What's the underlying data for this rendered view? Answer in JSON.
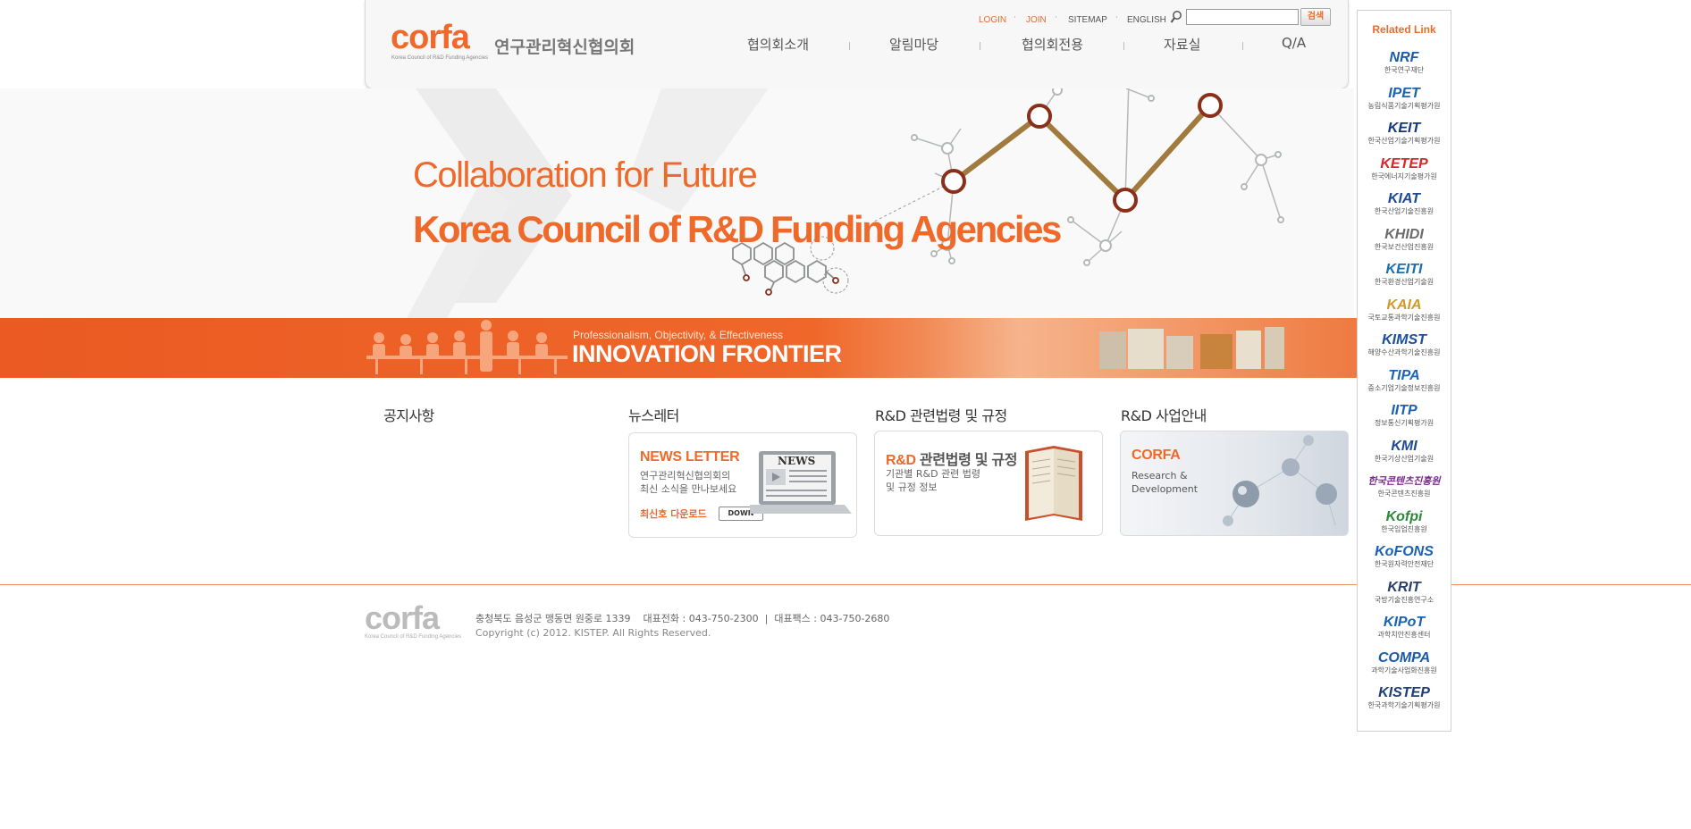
{
  "header": {
    "logo_word": "corfa",
    "logo_sub": "Korea Council of R&D Funding Agencies",
    "logo_ko": "연구관리혁신협의회",
    "util_links": {
      "login": "LOGIN",
      "join": "JOIN",
      "sitemap": "SITEMAP",
      "english": "ENGLISH"
    },
    "search": {
      "placeholder": "",
      "button_label": "검색"
    },
    "nav": [
      "협의회소개",
      "알림마당",
      "협의회전용",
      "자료실",
      "Q/A"
    ]
  },
  "hero": {
    "line1": "Collaboration for Future",
    "line2": "Korea Council of R&D Funding Agencies"
  },
  "band": {
    "small": "Professionalism, Objectivity, & Effectiveness",
    "big": "INNOVATION FRONTIER"
  },
  "sections": [
    {
      "title": "공지사항"
    },
    {
      "title": "뉴스레터",
      "card": {
        "title": "NEWS LETTER",
        "desc": "연구관리혁신협의회의\n최신 소식을 만나보세요",
        "download_label": "최신호 다운로드",
        "down_btn": "DOWN",
        "image_text": "NEWS"
      }
    },
    {
      "title": "R&D 관련법령 및 규정",
      "card": {
        "title_accent": "R&D",
        "title_rest": "관련법령 및 규정",
        "desc": "기관별 R&D 관련 법령\n및 규정 정보"
      }
    },
    {
      "title": "R&D 사업안내",
      "card": {
        "title": "CORFA",
        "desc": "Research &\nDevelopment"
      }
    }
  ],
  "footer": {
    "logo_word": "corfa",
    "logo_sub": "Korea Council of R&D Funding Agencies",
    "address": "충청북도 음성군 맹동면 원중로 1339    대표전화 : 043-750-2300  |  대표팩스 : 043-750-2680",
    "copyright": "Copyright (c) 2012. KISTEP. All Rights Reserved."
  },
  "related": {
    "title": "Related Link",
    "items": [
      {
        "logo": "NRF",
        "name": "한국연구재단",
        "color": "#1b5aa8"
      },
      {
        "logo": "IPET",
        "name": "농림식품기술기획평가원",
        "color": "#1b62b0"
      },
      {
        "logo": "KEIT",
        "name": "한국산업기술기획평가원",
        "color": "#12397a"
      },
      {
        "logo": "KETEP",
        "name": "한국에너지기술평가원",
        "color": "#d7262b"
      },
      {
        "logo": "KIAT",
        "name": "한국산업기술진흥원",
        "color": "#1d4a93"
      },
      {
        "logo": "KHIDI",
        "name": "한국보건산업진흥원",
        "color": "#6b6b6b"
      },
      {
        "logo": "KEITI",
        "name": "한국환경산업기술원",
        "color": "#1a6fb0"
      },
      {
        "logo": "KAIA",
        "name": "국토교통과학기술진흥원",
        "color": "#d39a2a"
      },
      {
        "logo": "KIMST",
        "name": "해양수산과학기술진흥원",
        "color": "#1b4f9c"
      },
      {
        "logo": "TIPA",
        "name": "중소기업기술정보진흥원",
        "color": "#1b65b8"
      },
      {
        "logo": "IITP",
        "name": "정보통신기획평가원",
        "color": "#1b62b0"
      },
      {
        "logo": "KMI",
        "name": "한국기상산업기술원",
        "color": "#1d4a93"
      },
      {
        "logo": "한국콘텐츠진흥원",
        "name": "한국콘텐츠진흥원",
        "color": "#7a2a8e"
      },
      {
        "logo": "Kofpi",
        "name": "한국임업진흥원",
        "color": "#2a8a3a"
      },
      {
        "logo": "KoFONS",
        "name": "한국원자력안전재단",
        "color": "#1b62b0"
      },
      {
        "logo": "KRIT",
        "name": "국방기술진흥연구소",
        "color": "#2a3e6b"
      },
      {
        "logo": "KIPoT",
        "name": "과학치안진흥센터",
        "color": "#1b62b0"
      },
      {
        "logo": "COMPA",
        "name": "과학기술사업화진흥원",
        "color": "#1b5aa8"
      },
      {
        "logo": "KISTEP",
        "name": "한국과학기술기획평가원",
        "color": "#1d3d7a"
      }
    ]
  },
  "colors": {
    "accent": "#ef6a2a",
    "band": "#ea5a22",
    "text": "#333333"
  }
}
